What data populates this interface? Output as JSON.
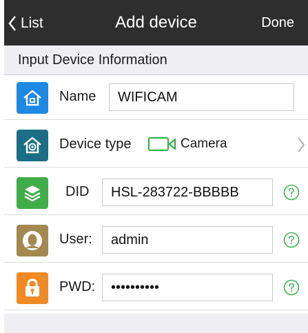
{
  "nav": {
    "back_label": "List",
    "title": "Add device",
    "done_label": "Done"
  },
  "section": {
    "title": "Input Device Information"
  },
  "form": {
    "name": {
      "label": "Name",
      "value": "WIFICAM",
      "icon": "home-icon",
      "icon_color": "#1E88E5"
    },
    "device_type": {
      "label": "Device type",
      "value": "Camera",
      "icon": "home-camera-icon",
      "icon_color": "#1B6E84",
      "value_icon": "video-camera-icon",
      "value_icon_color": "#2EAA3C"
    },
    "did": {
      "label": "DID",
      "value": "HSL-283722-BBBBB",
      "icon": "layers-icon",
      "icon_color": "#3FAE49"
    },
    "user": {
      "label": "User:",
      "value": "admin",
      "icon": "person-icon",
      "icon_color": "#A3894F"
    },
    "pwd": {
      "label": "PWD:",
      "value": "••••••••••",
      "icon": "lock-icon",
      "icon_color": "#F08A24"
    }
  },
  "colors": {
    "nav_bg": "#2E2E2E",
    "section_bg": "#EFEFF3",
    "help_icon": "#3FB34F"
  }
}
